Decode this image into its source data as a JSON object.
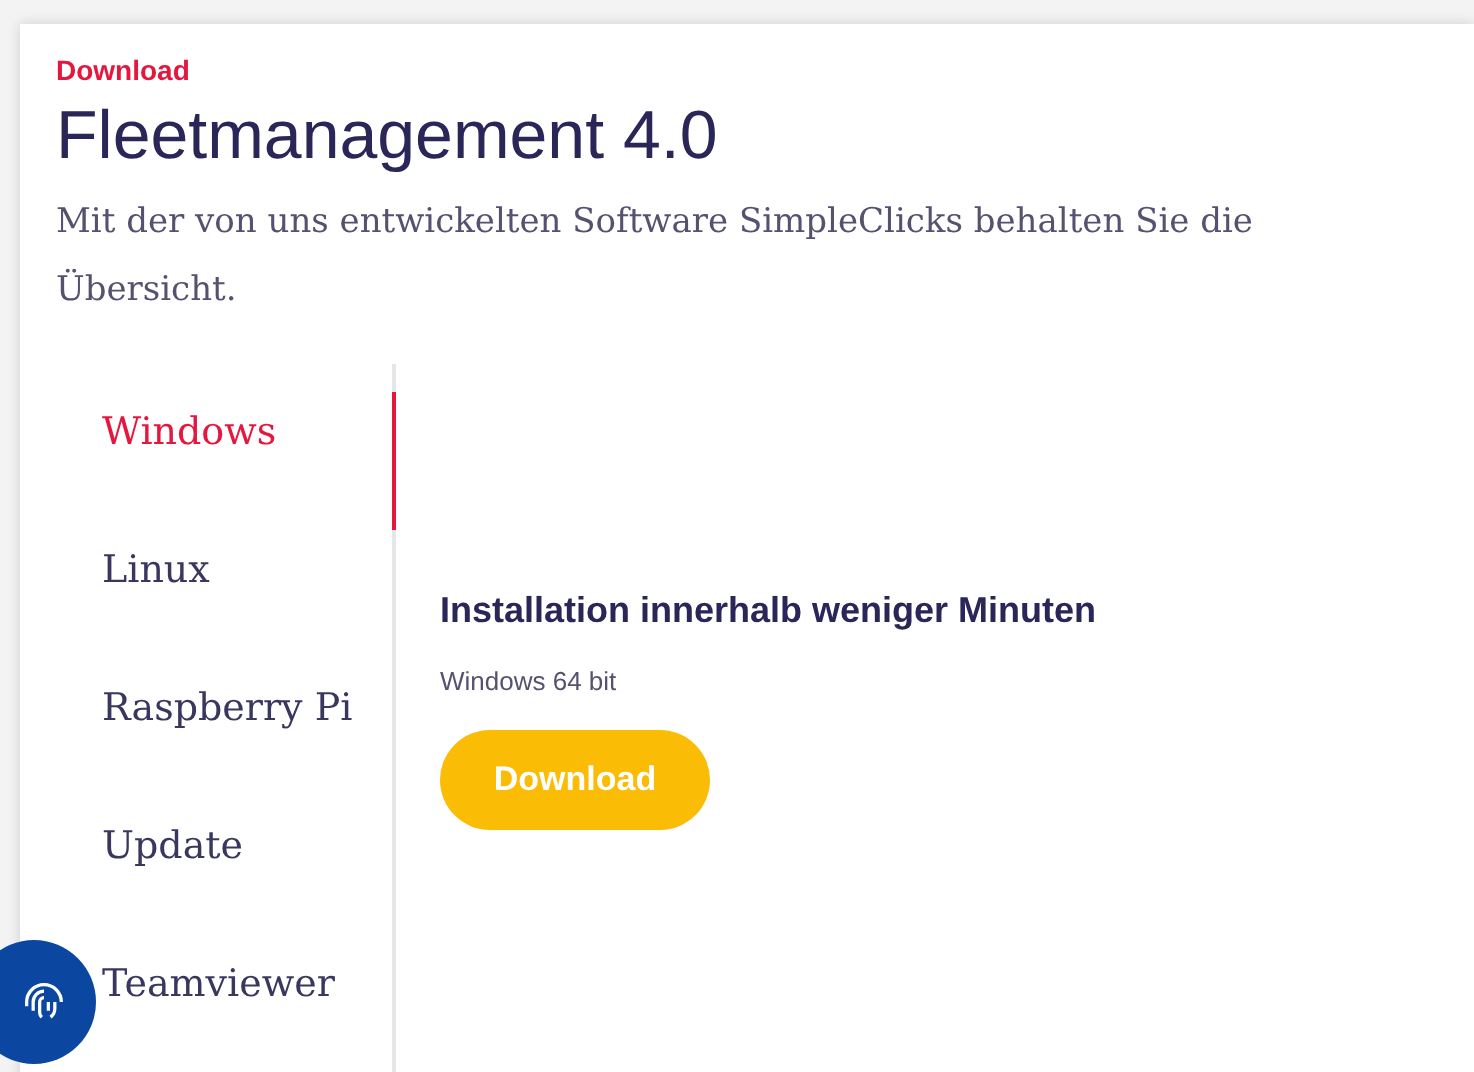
{
  "eyebrow": "Download",
  "title": "Fleetmanagement 4.0",
  "description": "Mit der von uns entwickelten Software SimpleClicks behalten Sie die Übersicht.",
  "tabs": [
    {
      "label": "Windows",
      "selected": true
    },
    {
      "label": "Linux",
      "selected": false
    },
    {
      "label": "Raspberry Pi",
      "selected": false
    },
    {
      "label": "Update",
      "selected": false
    },
    {
      "label": "Teamviewer",
      "selected": false
    }
  ],
  "panel": {
    "heading": "Installation innerhalb weniger Minuten",
    "subtitle": "Windows 64 bit",
    "button": "Download"
  }
}
